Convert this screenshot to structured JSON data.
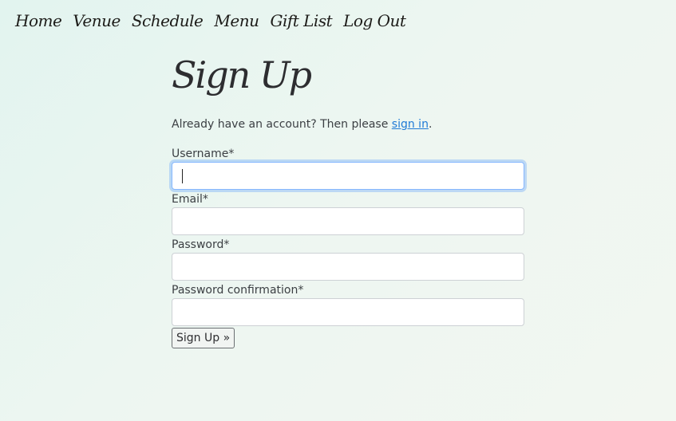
{
  "nav": {
    "items": [
      {
        "label": "Home"
      },
      {
        "label": "Venue"
      },
      {
        "label": "Schedule"
      },
      {
        "label": "Menu"
      },
      {
        "label": "Gift List"
      },
      {
        "label": "Log Out"
      }
    ]
  },
  "page": {
    "title": "Sign Up",
    "intro_text": "Already have an account? Then please ",
    "intro_link": "sign in",
    "intro_end": "."
  },
  "form": {
    "username_label": "Username*",
    "username_value": "",
    "email_label": "Email*",
    "email_value": "",
    "password_label": "Password*",
    "password_value": "",
    "password_confirmation_label": "Password confirmation*",
    "password_confirmation_value": "",
    "submit_label": "Sign Up »"
  }
}
